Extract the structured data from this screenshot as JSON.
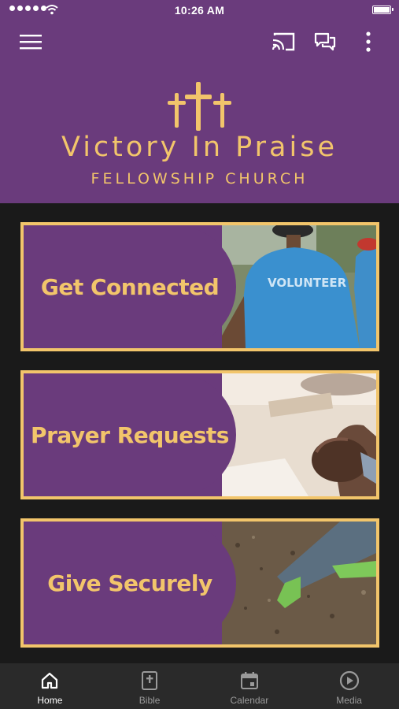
{
  "status_bar": {
    "time": "10:26 AM"
  },
  "toolbar": {
    "menu_icon": "hamburger-menu-icon",
    "cast_icon": "cast-icon",
    "chat_icon": "chat-icon",
    "more_icon": "more-vertical-icon"
  },
  "header": {
    "title": "Victory In Praise",
    "subtitle": "FELLOWSHIP CHURCH"
  },
  "cards": [
    {
      "label": "Get Connected",
      "image": "volunteer-photo"
    },
    {
      "label": "Prayer Requests",
      "image": "praying-hands-photo"
    },
    {
      "label": "Give Securely",
      "image": "planting-seedling-photo"
    }
  ],
  "tabs": [
    {
      "label": "Home",
      "icon": "home-icon",
      "active": true
    },
    {
      "label": "Bible",
      "icon": "bible-icon",
      "active": false
    },
    {
      "label": "Calendar",
      "icon": "calendar-icon",
      "active": false
    },
    {
      "label": "Media",
      "icon": "play-circle-icon",
      "active": false
    }
  ],
  "colors": {
    "brand_purple": "#6a3b7c",
    "gold": "#f2c56b",
    "background": "#1a1a1a",
    "tab_bar": "#2a2a2a"
  }
}
